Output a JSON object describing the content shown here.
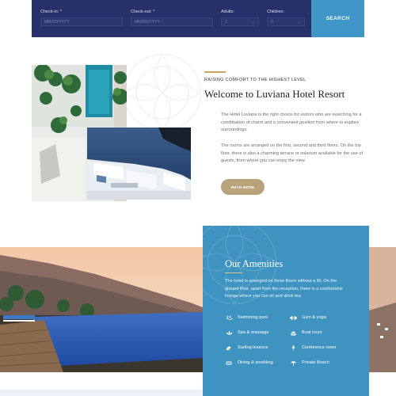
{
  "booking": {
    "checkin_label": "Check-in: *",
    "checkin_placeholder": "MM/DD/YYYY",
    "checkout_label": "Check-out: *",
    "checkout_placeholder": "MM/DD/YYYY",
    "adults_label": "Adults:",
    "adults_value": "1",
    "children_label": "Children:",
    "children_value": "0",
    "search_label": "SEARCH"
  },
  "welcome": {
    "kicker": "RAISING COMFORT TO THE HIGHEST LEVEL",
    "title": "Welcome to Luviana Hotel Resort",
    "paragraph1": "The Hotel Luviana is the right choice for visitors who are searching for a combination of charm and a convenient position from where to explore surroundings.",
    "paragraph2": "The rooms are arranged on the first, second and third floors. On the top floor, there is also a charming terrace or solarium available for the use of guests, from where you can enjoy the view.",
    "read_more": "READ MORE"
  },
  "amenities": {
    "title": "Our Amenities",
    "text": "The hotel is arranged on three floors without a lift. On the ground floor, apart from the reception, there is a comfortable lounge where you can sit and drink tea.",
    "items": [
      {
        "label": "Swimming pool",
        "icon": "swimming-pool-icon"
      },
      {
        "label": "Gym & yoga",
        "icon": "dumbbell-icon"
      },
      {
        "label": "Spa & massage",
        "icon": "lotus-icon"
      },
      {
        "label": "Boat tours",
        "icon": "boat-icon"
      },
      {
        "label": "Surfing lessons",
        "icon": "wave-icon"
      },
      {
        "label": "Conference room",
        "icon": "microphone-icon"
      },
      {
        "label": "Diving & snorkling",
        "icon": "snorkel-icon"
      },
      {
        "label": "Private Beach",
        "icon": "beach-umbrella-icon"
      }
    ]
  },
  "colors": {
    "navy": "#28306a",
    "blue": "#3f96c7",
    "gold": "#c8a55a",
    "tan": "#b9a37a"
  }
}
